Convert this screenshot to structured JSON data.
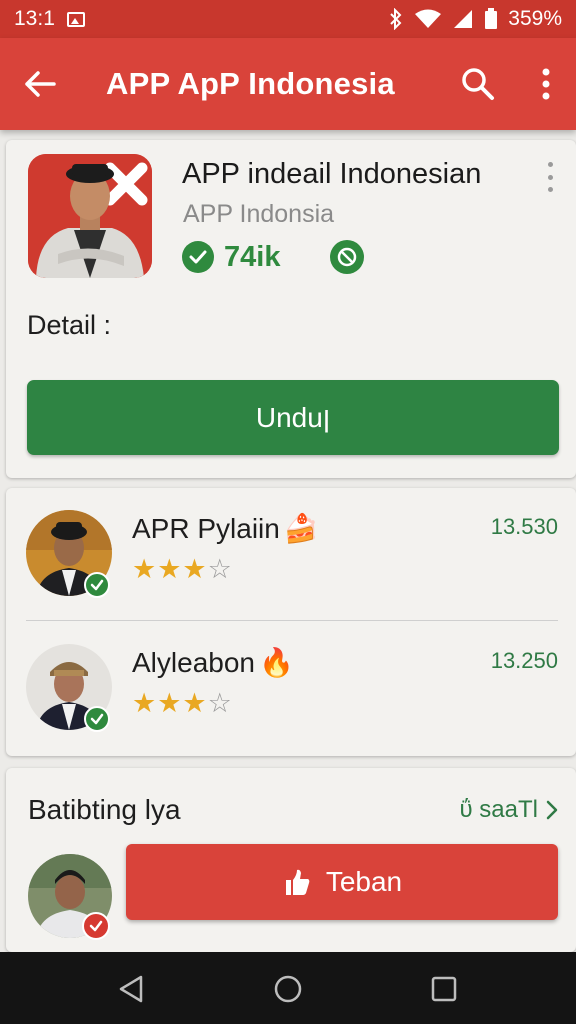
{
  "status_bar": {
    "time": "13:1",
    "battery": "359%",
    "icons": [
      "image-icon",
      "bluetooth-icon",
      "wifi-icon",
      "signal-icon",
      "battery-icon"
    ]
  },
  "app_bar": {
    "title": "APP ApP Indonesia",
    "color": "#d9433a",
    "icons": [
      "back-arrow-icon",
      "search-icon",
      "overflow-menu-icon"
    ]
  },
  "app_card": {
    "name": "APP indeail Indonesian",
    "subtitle": "APP Indonsia",
    "count": "74ik",
    "detail_label": "Detail :",
    "download_label": "Unduן",
    "download_color": "#2e8443",
    "icons": [
      "check-circle-icon",
      "no-sign-icon",
      "close-x-icon",
      "more-vert-icon"
    ]
  },
  "reviews": [
    {
      "name": "APR Pylaiin",
      "emoji": "🍰",
      "rating": 3,
      "max_rating": 4,
      "number": "13.530"
    },
    {
      "name": "Alyleabon",
      "emoji": "🔥",
      "rating": 3,
      "max_rating": 4,
      "number": "13.250"
    }
  ],
  "bottom_card": {
    "title": "Batibting lya",
    "see_all": "ΰ saaTl",
    "action_label": "Teban",
    "action_color": "#d9433a",
    "icons": [
      "chevron-right-icon",
      "thumbs-up-icon",
      "check-icon"
    ]
  },
  "nav_bar": {
    "icons": [
      "nav-back-icon",
      "nav-home-icon",
      "nav-recents-icon"
    ]
  }
}
